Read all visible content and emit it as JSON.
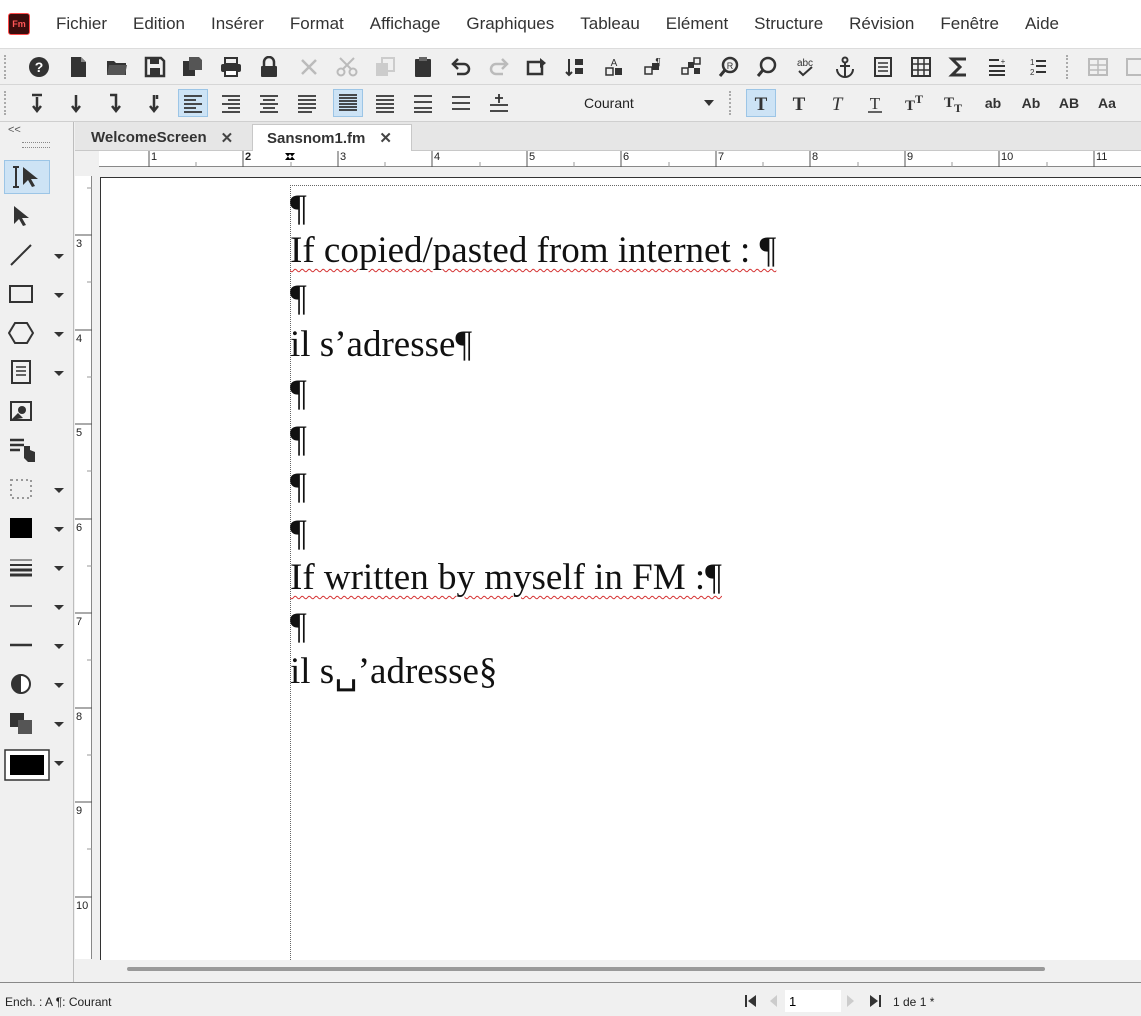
{
  "app": {
    "logo_text": "Fm"
  },
  "menu": [
    "Fichier",
    "Edition",
    "Insérer",
    "Format",
    "Affichage",
    "Graphiques",
    "Tableau",
    "Elément",
    "Structure",
    "Révision",
    "Fenêtre",
    "Aide"
  ],
  "toolbar": {
    "paragraph_format": "Courant"
  },
  "tool_panel": {
    "collapse_label": "<<"
  },
  "tabs": [
    {
      "label": "WelcomeScreen",
      "close": "✕"
    },
    {
      "label": "Sansnom1.fm",
      "close": "✕"
    }
  ],
  "ruler": {
    "horizontal": [
      "1",
      "2",
      "3",
      "4",
      "5",
      "6",
      "7",
      "8",
      "9",
      "10",
      "11"
    ],
    "vertical": [
      "3",
      "4",
      "5",
      "6",
      "7",
      "8",
      "9",
      "10"
    ]
  },
  "document": {
    "lines": [
      "¶",
      "If copied/pasted from internet : ¶",
      " ¶",
      "il s’adresse¶",
      "¶",
      "¶",
      "¶",
      "¶",
      "If written by myself in FM :¶",
      "¶",
      "il s␣’adresse§"
    ]
  },
  "status": {
    "left": "Ench. : A  ¶: Courant",
    "page_input": "1",
    "page_count": "1 de 1 *"
  },
  "colors": {
    "accent": "#cde3f5",
    "spell_error": "#d43030",
    "grammar": "#2a9a2a"
  }
}
